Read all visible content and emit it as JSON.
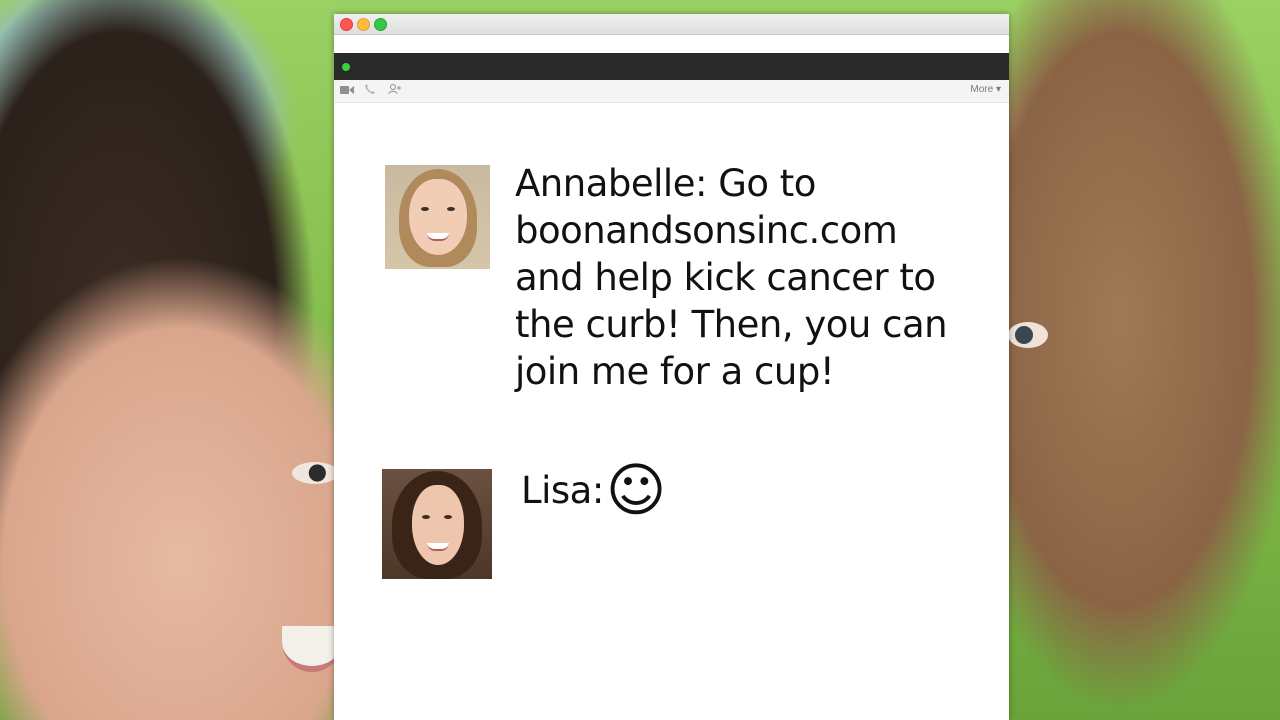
{
  "toolbar": {
    "more_label": "More ▾",
    "icons": [
      "video-camera-icon",
      "phone-icon",
      "add-user-icon"
    ]
  },
  "messages": [
    {
      "sender": "Annabelle:",
      "text": "Go to boonandsonsinc.com and help kick cancer to the curb! Then, you can join me for a cup!"
    },
    {
      "sender": "Lisa:",
      "emoji": "☺"
    }
  ],
  "colors": {
    "status_online": "#3bd13b",
    "darkbar": "#2a2a2a",
    "close": "#fc5753",
    "minimize": "#fdbc40",
    "zoom": "#34c84a"
  }
}
